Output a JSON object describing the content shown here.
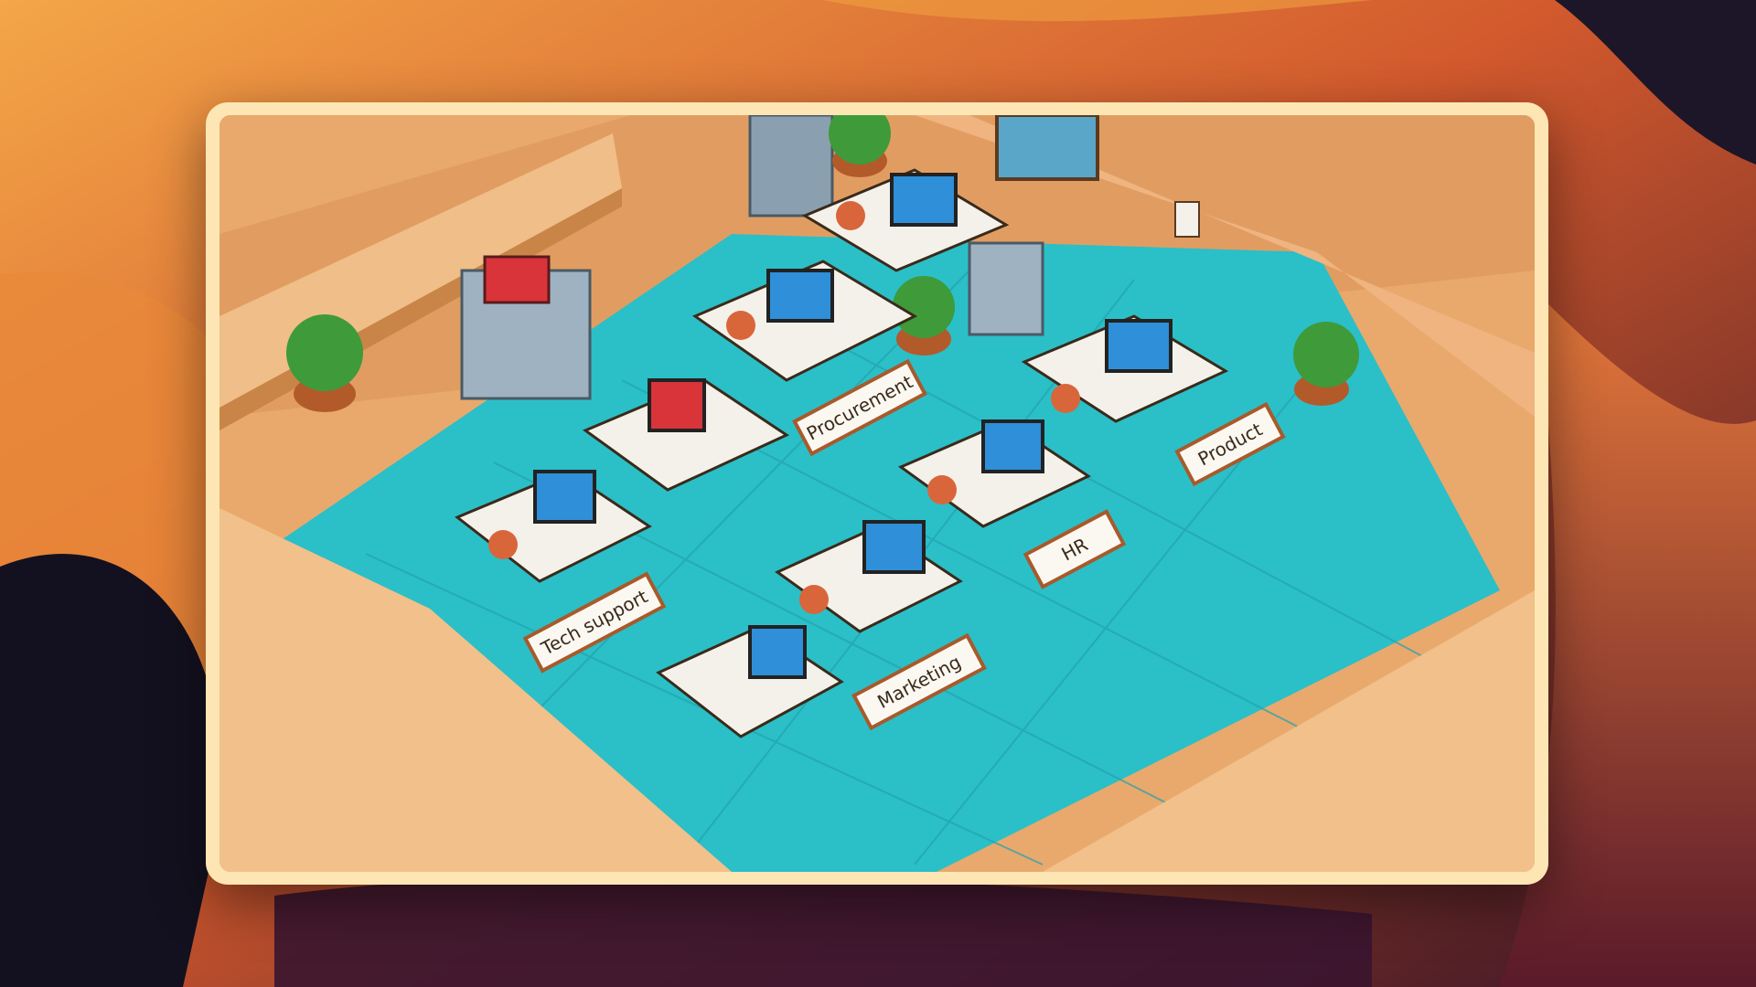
{
  "background": {
    "colors": {
      "top_left": "#f2a040",
      "top_right": "#e07a30",
      "mid": "#c8502a",
      "bottom": "#2a1222",
      "dark": "#12101c"
    }
  },
  "scene": {
    "colors": {
      "floor": "#2bbfc8",
      "wall": "#e4a467",
      "partition": "#efb87e",
      "desk": "#f4f1ea",
      "chair": "#d8663a",
      "frame_border": "#fde6b4",
      "sign_border": "#a85a2a"
    },
    "desk_labels": [
      {
        "id": "procurement",
        "text": "Procurement"
      },
      {
        "id": "product",
        "text": "Product"
      },
      {
        "id": "hr",
        "text": "HR"
      },
      {
        "id": "tech-support",
        "text": "Tech support"
      },
      {
        "id": "marketing",
        "text": "Marketing"
      }
    ]
  }
}
